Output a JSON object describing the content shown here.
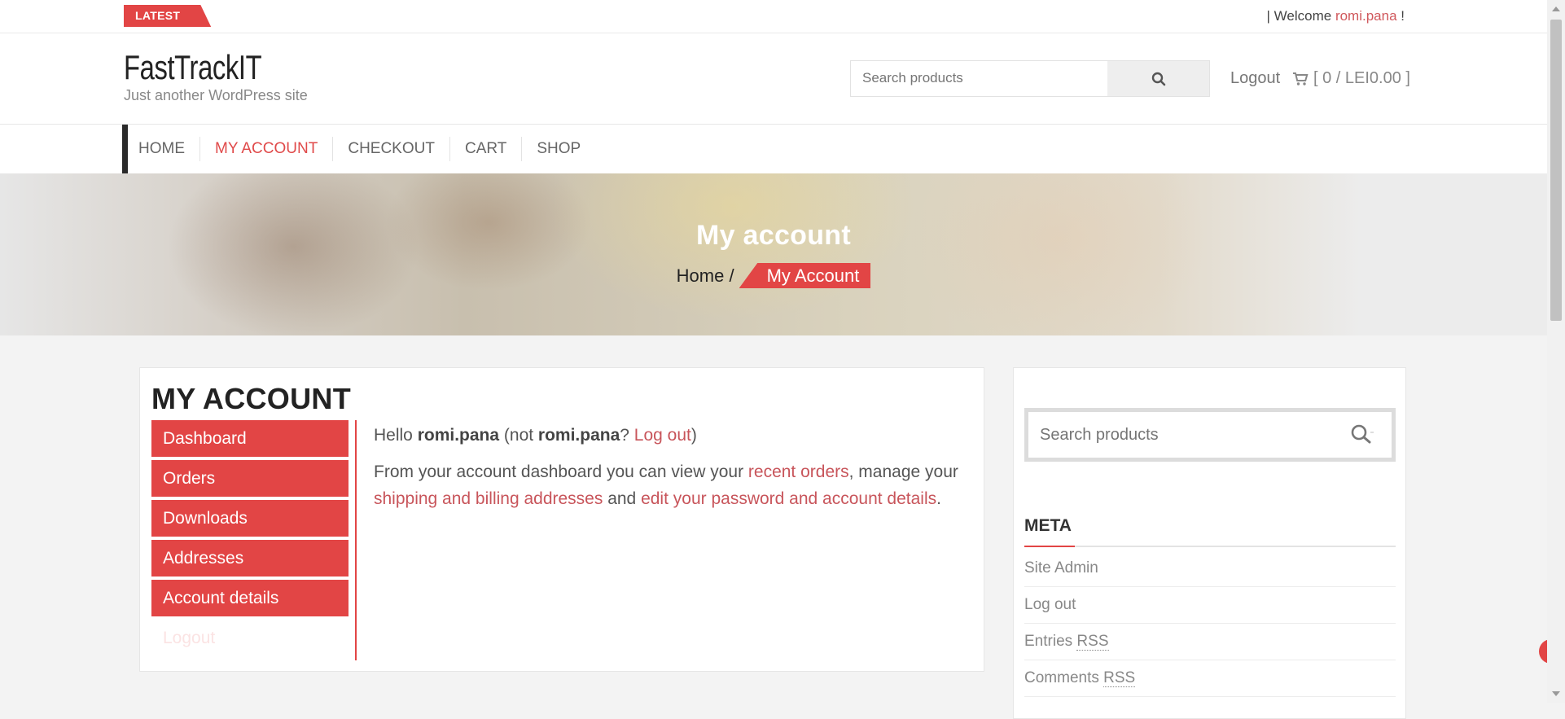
{
  "topbar": {
    "latest_label": "LATEST",
    "welcome_prefix": "| Welcome ",
    "welcome_user": "romi.pana",
    "welcome_suffix": " !"
  },
  "header": {
    "site_title": "FastTrackIT",
    "tagline": "Just another WordPress site",
    "search_placeholder": "Search products",
    "logout_label": "Logout",
    "cart_label": "[ 0 / LEI0.00 ]"
  },
  "nav": {
    "items": [
      {
        "label": "HOME",
        "active": false
      },
      {
        "label": "MY ACCOUNT",
        "active": true
      },
      {
        "label": "CHECKOUT",
        "active": false
      },
      {
        "label": "CART",
        "active": false
      },
      {
        "label": "SHOP",
        "active": false
      }
    ]
  },
  "hero": {
    "title": "My account",
    "crumb_home": "Home",
    "crumb_sep": " /",
    "crumb_current": "My Account"
  },
  "account": {
    "title": "MY ACCOUNT",
    "menu": [
      "Dashboard",
      "Orders",
      "Downloads",
      "Addresses",
      "Account details",
      "Logout"
    ],
    "hello_prefix": "Hello ",
    "hello_user": "romi.pana",
    "hello_not": " (not ",
    "hello_user2": "romi.pana",
    "hello_q": "? ",
    "hello_logout": "Log out",
    "hello_close": ")",
    "dash_text_1": "From your account dashboard you can view your ",
    "dash_link_orders": "recent orders",
    "dash_text_2": ", manage your ",
    "dash_link_addresses": "shipping and billing addresses",
    "dash_text_3": " and ",
    "dash_link_password": "edit your password and account details",
    "dash_text_4": "."
  },
  "sidebar": {
    "search_placeholder": "Search products",
    "meta_title": "META",
    "meta_items": [
      "Site Admin",
      "Log out",
      "Entries",
      "Comments"
    ],
    "rss_label": "RSS"
  },
  "colors": {
    "accent": "#e24545",
    "link": "#c8555b"
  }
}
